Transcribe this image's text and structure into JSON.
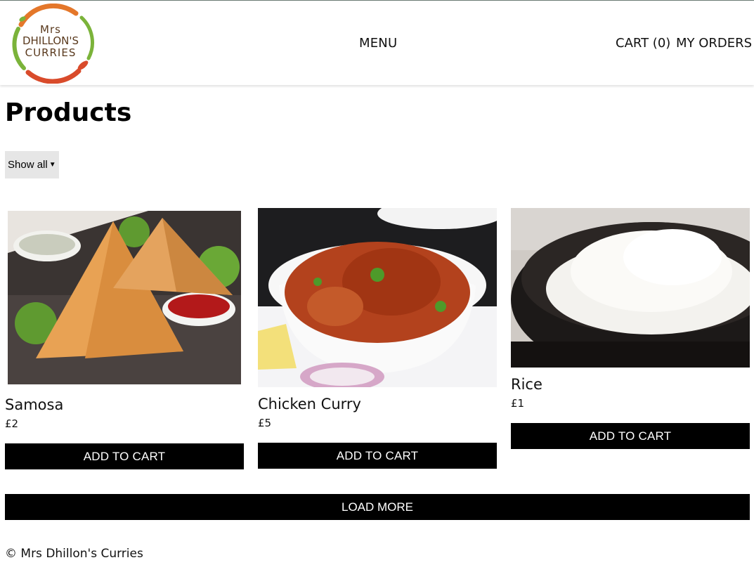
{
  "brand": {
    "logo_text_line1": "Mrs",
    "logo_text_line2": "DHILLON'S",
    "logo_text_line3": "CURRIES",
    "colors": {
      "orange": "#e4772a",
      "green": "#7bb33a",
      "red": "#d94b2b",
      "text": "#5a3a1e"
    }
  },
  "nav": {
    "menu_label": "MENU",
    "cart_label": "CART (0)",
    "orders_label": "MY ORDERS"
  },
  "page": {
    "title": "Products"
  },
  "filter": {
    "selected": "Show all"
  },
  "products": [
    {
      "name": "Samosa",
      "price": "£2",
      "button": "ADD TO CART",
      "image_icon": "samosa-image"
    },
    {
      "name": "Chicken Curry",
      "price": "£5",
      "button": "ADD TO CART",
      "image_icon": "chicken-curry-image"
    },
    {
      "name": "Rice",
      "price": "£1",
      "button": "ADD TO CART",
      "image_icon": "rice-image"
    }
  ],
  "load_more_label": "LOAD MORE",
  "footer": {
    "text": "© Mrs Dhillon's Curries"
  }
}
